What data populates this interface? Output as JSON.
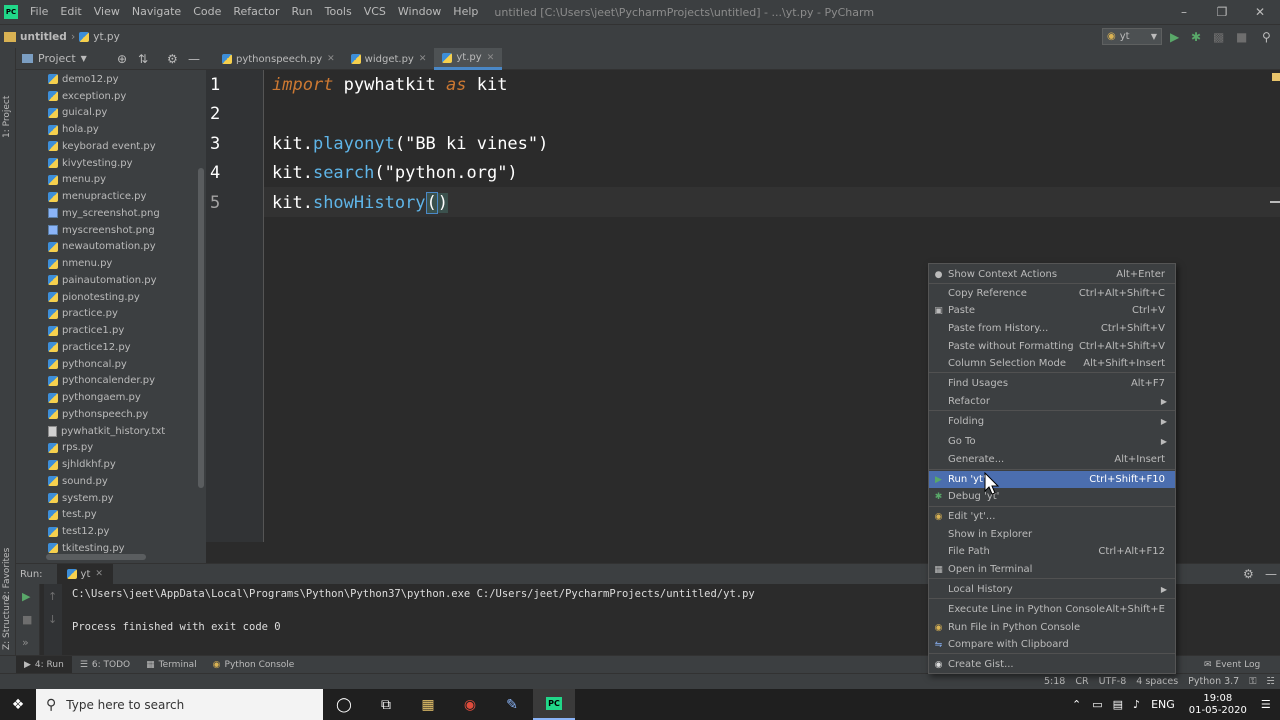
{
  "titlebar": {
    "menus": [
      "File",
      "Edit",
      "View",
      "Navigate",
      "Code",
      "Refactor",
      "Run",
      "Tools",
      "VCS",
      "Window",
      "Help"
    ],
    "title": "untitled [C:\\Users\\jeet\\PycharmProjects\\untitled] - ...\\yt.py - PyCharm"
  },
  "navbar": {
    "project": "untitled",
    "file": "yt.py",
    "run_config": "yt"
  },
  "left_strip": {
    "project": "1: Project",
    "favorites": "2: Favorites",
    "structure": "Z: Structure"
  },
  "project_panel": {
    "header": "Project",
    "files": [
      {
        "name": "demo12.py",
        "type": "py"
      },
      {
        "name": "exception.py",
        "type": "py"
      },
      {
        "name": "guical.py",
        "type": "py"
      },
      {
        "name": "hola.py",
        "type": "py"
      },
      {
        "name": "keyborad event.py",
        "type": "py"
      },
      {
        "name": "kivytesting.py",
        "type": "py"
      },
      {
        "name": "menu.py",
        "type": "py"
      },
      {
        "name": "menupractice.py",
        "type": "py"
      },
      {
        "name": "my_screenshot.png",
        "type": "img"
      },
      {
        "name": "myscreenshot.png",
        "type": "img"
      },
      {
        "name": "newautomation.py",
        "type": "py"
      },
      {
        "name": "nmenu.py",
        "type": "py"
      },
      {
        "name": "painautomation.py",
        "type": "py"
      },
      {
        "name": "pionotesting.py",
        "type": "py"
      },
      {
        "name": "practice.py",
        "type": "py"
      },
      {
        "name": "practice1.py",
        "type": "py"
      },
      {
        "name": "practice12.py",
        "type": "py"
      },
      {
        "name": "pythoncal.py",
        "type": "py"
      },
      {
        "name": "pythoncalender.py",
        "type": "py"
      },
      {
        "name": "pythongaem.py",
        "type": "py"
      },
      {
        "name": "pythonspeech.py",
        "type": "py"
      },
      {
        "name": "pywhatkit_history.txt",
        "type": "txt"
      },
      {
        "name": "rps.py",
        "type": "py"
      },
      {
        "name": "sjhldkhf.py",
        "type": "py"
      },
      {
        "name": "sound.py",
        "type": "py"
      },
      {
        "name": "system.py",
        "type": "py"
      },
      {
        "name": "test.py",
        "type": "py"
      },
      {
        "name": "test12.py",
        "type": "py"
      },
      {
        "name": "tkitesting.py",
        "type": "py"
      }
    ]
  },
  "editor_tabs": [
    "pythonspeech.py",
    "widget.py",
    "yt.py"
  ],
  "code": {
    "line_numbers": [
      "1",
      "2",
      "3",
      "4",
      "5"
    ],
    "l1_import": "import",
    "l1_mod": " pywhatkit ",
    "l1_as": "as",
    "l1_alias": " kit",
    "l3_obj": "kit.",
    "l3_fn": "playonyt",
    "l3_arg": "(\"BB ki vines\")",
    "l4_obj": "kit.",
    "l4_fn": "search",
    "l4_arg": "(\"python.org\")",
    "l5_obj": "kit.",
    "l5_fn": "showHistory",
    "l5_open": "(",
    "l5_close": ")"
  },
  "run_panel": {
    "label": "Run:",
    "config": "yt",
    "cmd": "C:\\Users\\jeet\\AppData\\Local\\Programs\\Python\\Python37\\python.exe C:/Users/jeet/PycharmProjects/untitled/yt.py",
    "result": "Process finished with exit code 0"
  },
  "bottom_tabs": [
    "4: Run",
    "6: TODO",
    "Terminal",
    "Python Console"
  ],
  "event_log": "Event Log",
  "statusbar": {
    "pos": "5:18",
    "eol": "CR",
    "enc": "UTF-8",
    "indent": "4 spaces",
    "interp": "Python 3.7"
  },
  "taskbar": {
    "search_placeholder": "Type here to search",
    "lang": "ENG",
    "time": "19:08",
    "date": "01-05-2020"
  },
  "context_menu": {
    "items": [
      {
        "label": "Show Context Actions",
        "shortcut": "Alt+Enter",
        "icon": "bulb-icon"
      },
      {
        "label": "Copy Reference",
        "shortcut": "Ctrl+Alt+Shift+C"
      },
      {
        "label": "Paste",
        "shortcut": "Ctrl+V",
        "icon": "paste-icon"
      },
      {
        "label": "Paste from History...",
        "shortcut": "Ctrl+Shift+V"
      },
      {
        "label": "Paste without Formatting",
        "shortcut": "Ctrl+Alt+Shift+V"
      },
      {
        "label": "Column Selection Mode",
        "shortcut": "Alt+Shift+Insert"
      },
      {
        "label": "Find Usages",
        "shortcut": "Alt+F7"
      },
      {
        "label": "Refactor",
        "submenu": true
      },
      {
        "label": "Folding",
        "submenu": true
      },
      {
        "label": "Go To",
        "submenu": true
      },
      {
        "label": "Generate...",
        "shortcut": "Alt+Insert"
      },
      {
        "label": "Run 'yt'",
        "shortcut": "Ctrl+Shift+F10",
        "icon": "run-icon",
        "selected": true
      },
      {
        "label": "Debug 'yt'",
        "icon": "debug-icon"
      },
      {
        "label": "Edit 'yt'...",
        "icon": "python-icon"
      },
      {
        "label": "Show in Explorer"
      },
      {
        "label": "File Path",
        "shortcut": "Ctrl+Alt+F12"
      },
      {
        "label": "Open in Terminal",
        "icon": "terminal-icon"
      },
      {
        "label": "Local History",
        "submenu": true
      },
      {
        "label": "Execute Line in Python Console",
        "shortcut": "Alt+Shift+E"
      },
      {
        "label": "Run File in Python Console",
        "icon": "python-icon"
      },
      {
        "label": "Compare with Clipboard",
        "icon": "compare-icon"
      },
      {
        "label": "Create Gist...",
        "icon": "github-icon"
      }
    ]
  }
}
